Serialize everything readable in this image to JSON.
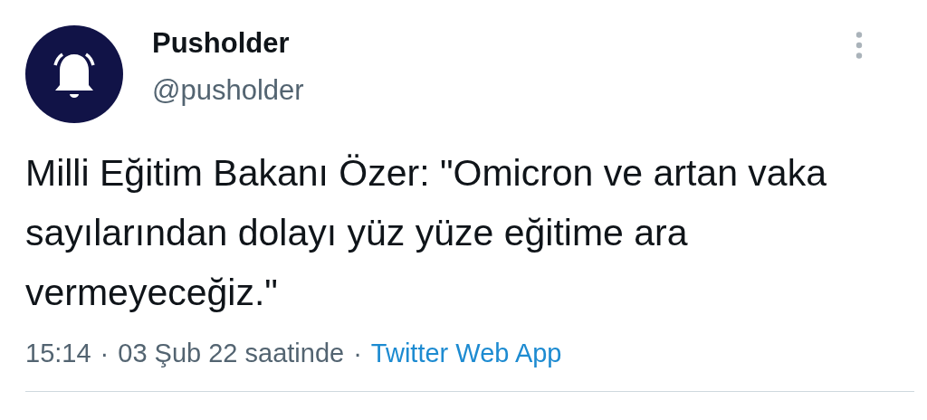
{
  "author": {
    "name": "Pusholder",
    "handle": "@pusholder"
  },
  "tweet": {
    "text": "Milli Eğitim Bakanı Özer: \"Omicron ve artan vaka sayılarından dolayı yüz yüze eğitime ara vermeyeceğiz.\""
  },
  "meta": {
    "time": "15:14",
    "separator_1": "·",
    "date": "03 Şub 22 saatinde",
    "separator_2": "·",
    "source": "Twitter Web App"
  }
}
